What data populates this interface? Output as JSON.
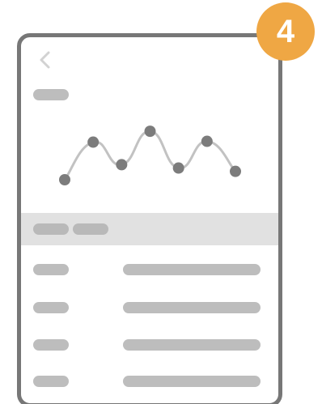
{
  "badge": {
    "number": "4",
    "color": "#efa744"
  },
  "screen": {
    "back_icon": "chevron-left-icon",
    "chart_data": {
      "type": "line",
      "x": [
        0,
        1,
        2,
        3,
        4,
        5,
        6
      ],
      "values": [
        0.0,
        0.45,
        0.18,
        0.58,
        0.14,
        0.46,
        0.1
      ],
      "ylim": [
        0,
        0.62
      ],
      "grid": false,
      "xlabel": "",
      "ylabel": "",
      "title": ""
    },
    "rows": [
      {
        "key": "",
        "value": ""
      },
      {
        "key": "",
        "value": ""
      },
      {
        "key": "",
        "value": ""
      },
      {
        "key": "",
        "value": ""
      }
    ]
  }
}
